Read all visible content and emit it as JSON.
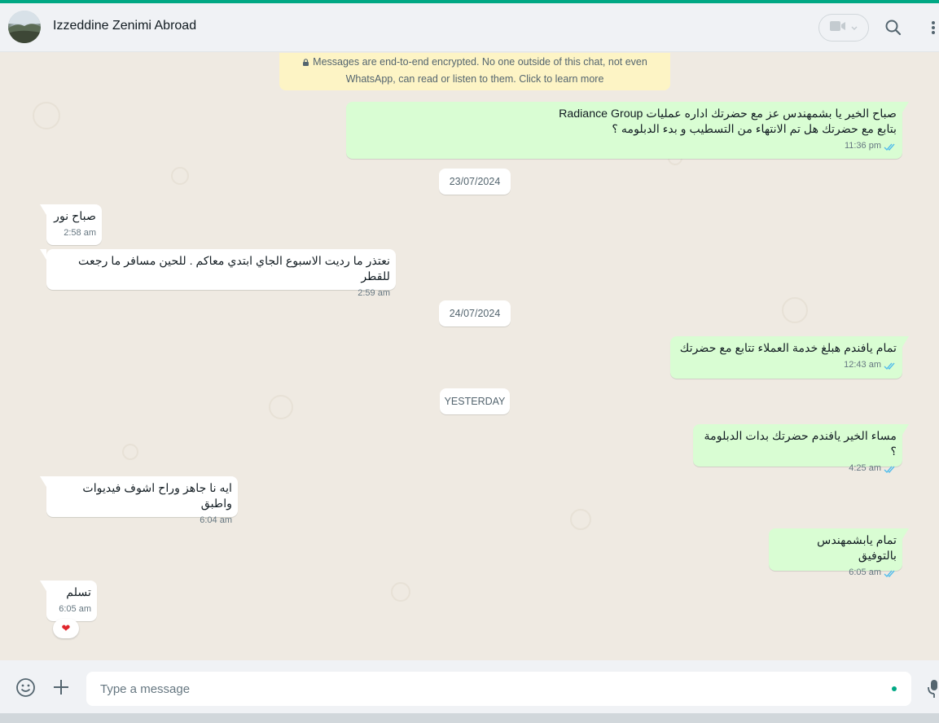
{
  "header": {
    "contact_name": "Izzeddine Zenimi Abroad",
    "avatar_icon": "contact-avatar",
    "video_icon": "video-camera-icon",
    "search_icon": "search-icon",
    "menu_icon": "kebab-menu-icon"
  },
  "chat": {
    "encryption_notice": "Messages are end-to-end encrypted. No one outside of this chat, not even WhatsApp, can read or listen to them. Click to learn more",
    "date_1": "23/07/2024",
    "date_2": "24/07/2024",
    "date_3": "YESTERDAY",
    "messages": [
      {
        "direction": "out",
        "text": "صباح الخير يا بشمهندس عز مع  حضرتك اداره عمليات Radiance Group\nبتابع مع حضرتك هل تم الانتهاء من التسطيب و بدء الدبلومه ؟",
        "time": "11:36 pm",
        "status": "read"
      },
      {
        "direction": "in",
        "text": "صباح نور",
        "time": "2:58 am"
      },
      {
        "direction": "in",
        "text": "نعتذر ما رديت الاسبوع الجاي ابتدي معاكم . للحين مسافر ما رجعت للقطر",
        "time": "2:59 am"
      },
      {
        "direction": "out",
        "text": "تمام يافندم هبلغ خدمة العملاء تتابع مع حضرتك",
        "time": "12:43 am",
        "status": "read"
      },
      {
        "direction": "out",
        "text": "مساء الخير يافندم حضرتك بدات الدبلومة ؟",
        "time": "4:25 am",
        "status": "read"
      },
      {
        "direction": "in",
        "text": "ايه نا جاهز وراح اشوف فيديوات واطبق",
        "time": "6:04 am"
      },
      {
        "direction": "out",
        "text": "تمام يابشمهندس بالتوفيق",
        "time": "6:05 am",
        "status": "read"
      },
      {
        "direction": "in",
        "text": "تسلم",
        "time": "6:05 am",
        "reaction": "❤"
      }
    ]
  },
  "footer": {
    "placeholder": "Type a message",
    "emoji_icon": "emoji-icon",
    "attach_icon": "plus-icon",
    "mic_icon": "microphone-icon"
  },
  "colors": {
    "accent": "#00a884",
    "outgoing_bubble": "#d9fdd3",
    "incoming_bubble": "#ffffff",
    "chat_background": "#efeae2",
    "notice_background": "#fdf4c5",
    "read_ticks": "#53bdeb",
    "reaction_heart": "#e0262d"
  }
}
